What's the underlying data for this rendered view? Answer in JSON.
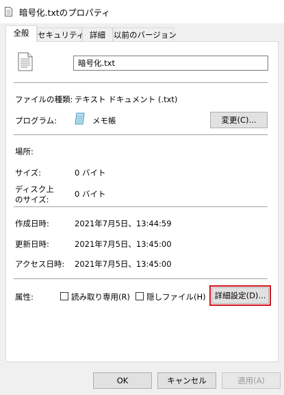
{
  "window": {
    "title": "暗号化.txtのプロパティ",
    "accent": "#d0111b"
  },
  "tabs": [
    {
      "label": "全般",
      "active": true
    },
    {
      "label": "セキュリティ",
      "active": false
    },
    {
      "label": "詳細",
      "active": false
    },
    {
      "label": "以前のバージョン",
      "active": false
    }
  ],
  "general": {
    "file_icon": "text-document-icon",
    "filename": "暗号化.txt",
    "type_label": "ファイルの種類:",
    "type_value": "テキスト ドキュメント (.txt)",
    "program_label": "プログラム:",
    "program_icon": "notepad-icon",
    "program_value": "メモ帳",
    "change_button": "変更(C)...",
    "location_label": "場所:",
    "location_value": "",
    "size_label": "サイズ:",
    "size_value": "0 バイト",
    "disk_size_label_line1": "ディスク上",
    "disk_size_label_line2": "のサイズ:",
    "disk_size_value": "0 バイト",
    "created_label": "作成日時:",
    "created_value": "2021年7月5日、13:44:59",
    "modified_label": "更新日時:",
    "modified_value": "2021年7月5日、13:45:00",
    "accessed_label": "アクセス日時:",
    "accessed_value": "2021年7月5日、13:45:00",
    "attributes_label": "属性:",
    "readonly_label": "読み取り専用(R)",
    "readonly_checked": false,
    "hidden_label": "隠しファイル(H)",
    "hidden_checked": false,
    "advanced_button": "詳細設定(D)..."
  },
  "footer": {
    "ok": "OK",
    "cancel": "キャンセル",
    "apply": "適用(A)"
  }
}
